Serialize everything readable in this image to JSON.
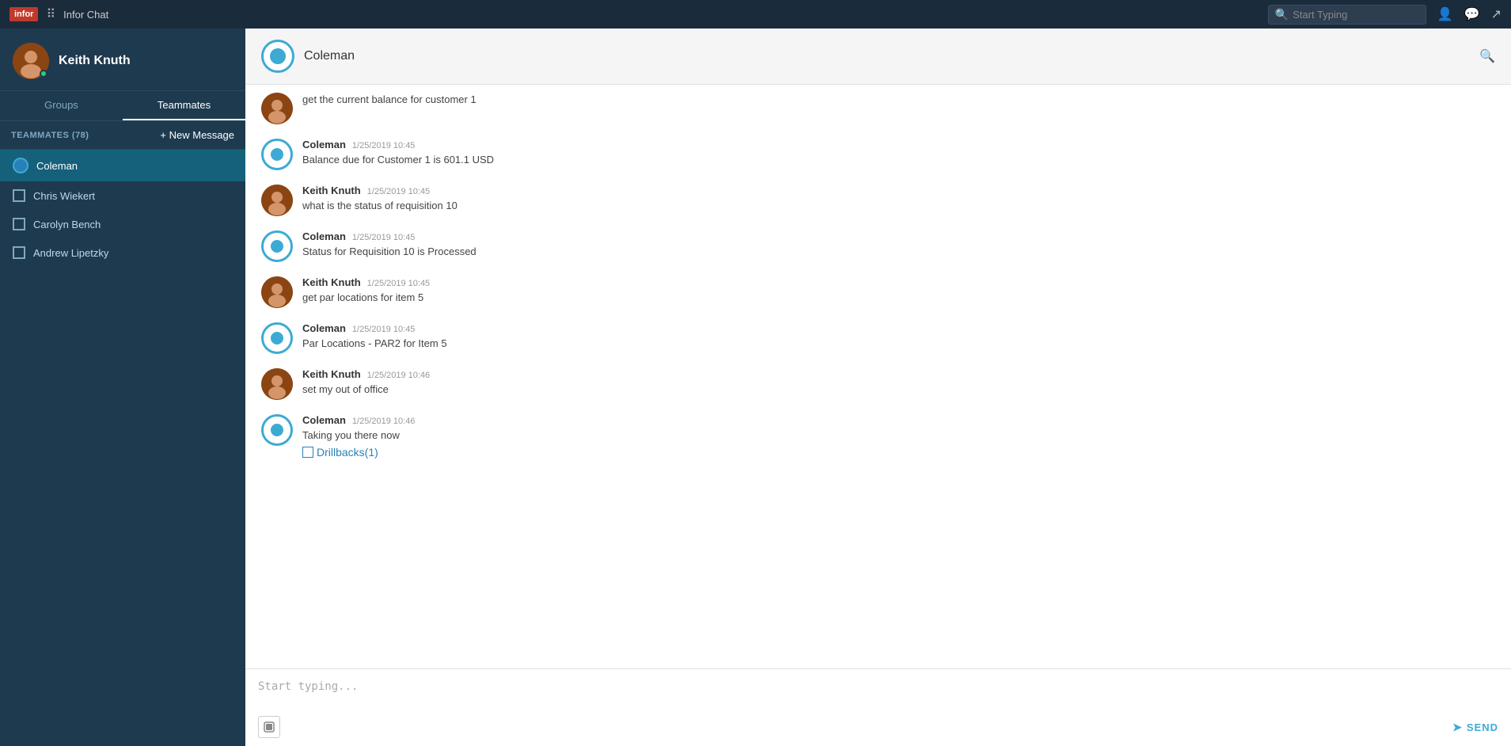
{
  "app": {
    "logo": "infor",
    "title": "Infor Chat"
  },
  "topbar": {
    "search_placeholder": "Start Typing"
  },
  "sidebar": {
    "username": "Keith Knuth",
    "tabs": [
      {
        "label": "Groups",
        "active": false
      },
      {
        "label": "Teammates",
        "active": true
      }
    ],
    "teammates_label": "TEAMMATES (78)",
    "new_message_label": "+ New Message",
    "contacts": [
      {
        "name": "Coleman",
        "active": true
      },
      {
        "name": "Chris Wiekert",
        "active": false
      },
      {
        "name": "Carolyn Bench",
        "active": false
      },
      {
        "name": "Andrew Lipetzky",
        "active": false
      }
    ]
  },
  "chat": {
    "recipient": "Coleman",
    "messages": [
      {
        "id": "msg-1",
        "sender": "",
        "is_bot": false,
        "is_partial": true,
        "text": "get the current balance for customer 1",
        "time": ""
      },
      {
        "id": "msg-2",
        "sender": "Coleman",
        "is_bot": true,
        "text": "Balance due for Customer 1 is 601.1 USD",
        "time": "1/25/2019 10:45"
      },
      {
        "id": "msg-3",
        "sender": "Keith Knuth",
        "is_bot": false,
        "text": "what is the status of requisition 10",
        "time": "1/25/2019 10:45"
      },
      {
        "id": "msg-4",
        "sender": "Coleman",
        "is_bot": true,
        "text": "Status for Requisition 10 is Processed",
        "time": "1/25/2019 10:45"
      },
      {
        "id": "msg-5",
        "sender": "Keith Knuth",
        "is_bot": false,
        "text": "get par locations for item 5",
        "time": "1/25/2019 10:45"
      },
      {
        "id": "msg-6",
        "sender": "Coleman",
        "is_bot": true,
        "text": "Par Locations - PAR2 for Item 5",
        "time": "1/25/2019 10:45"
      },
      {
        "id": "msg-7",
        "sender": "Keith Knuth",
        "is_bot": false,
        "text": "set my out of office",
        "time": "1/25/2019 10:46"
      },
      {
        "id": "msg-8",
        "sender": "Coleman",
        "is_bot": true,
        "text": "Taking you there now",
        "time": "1/25/2019 10:46",
        "drillback": "Drillbacks(1)"
      }
    ],
    "input_placeholder": "Start typing...",
    "send_label": "SEND"
  }
}
